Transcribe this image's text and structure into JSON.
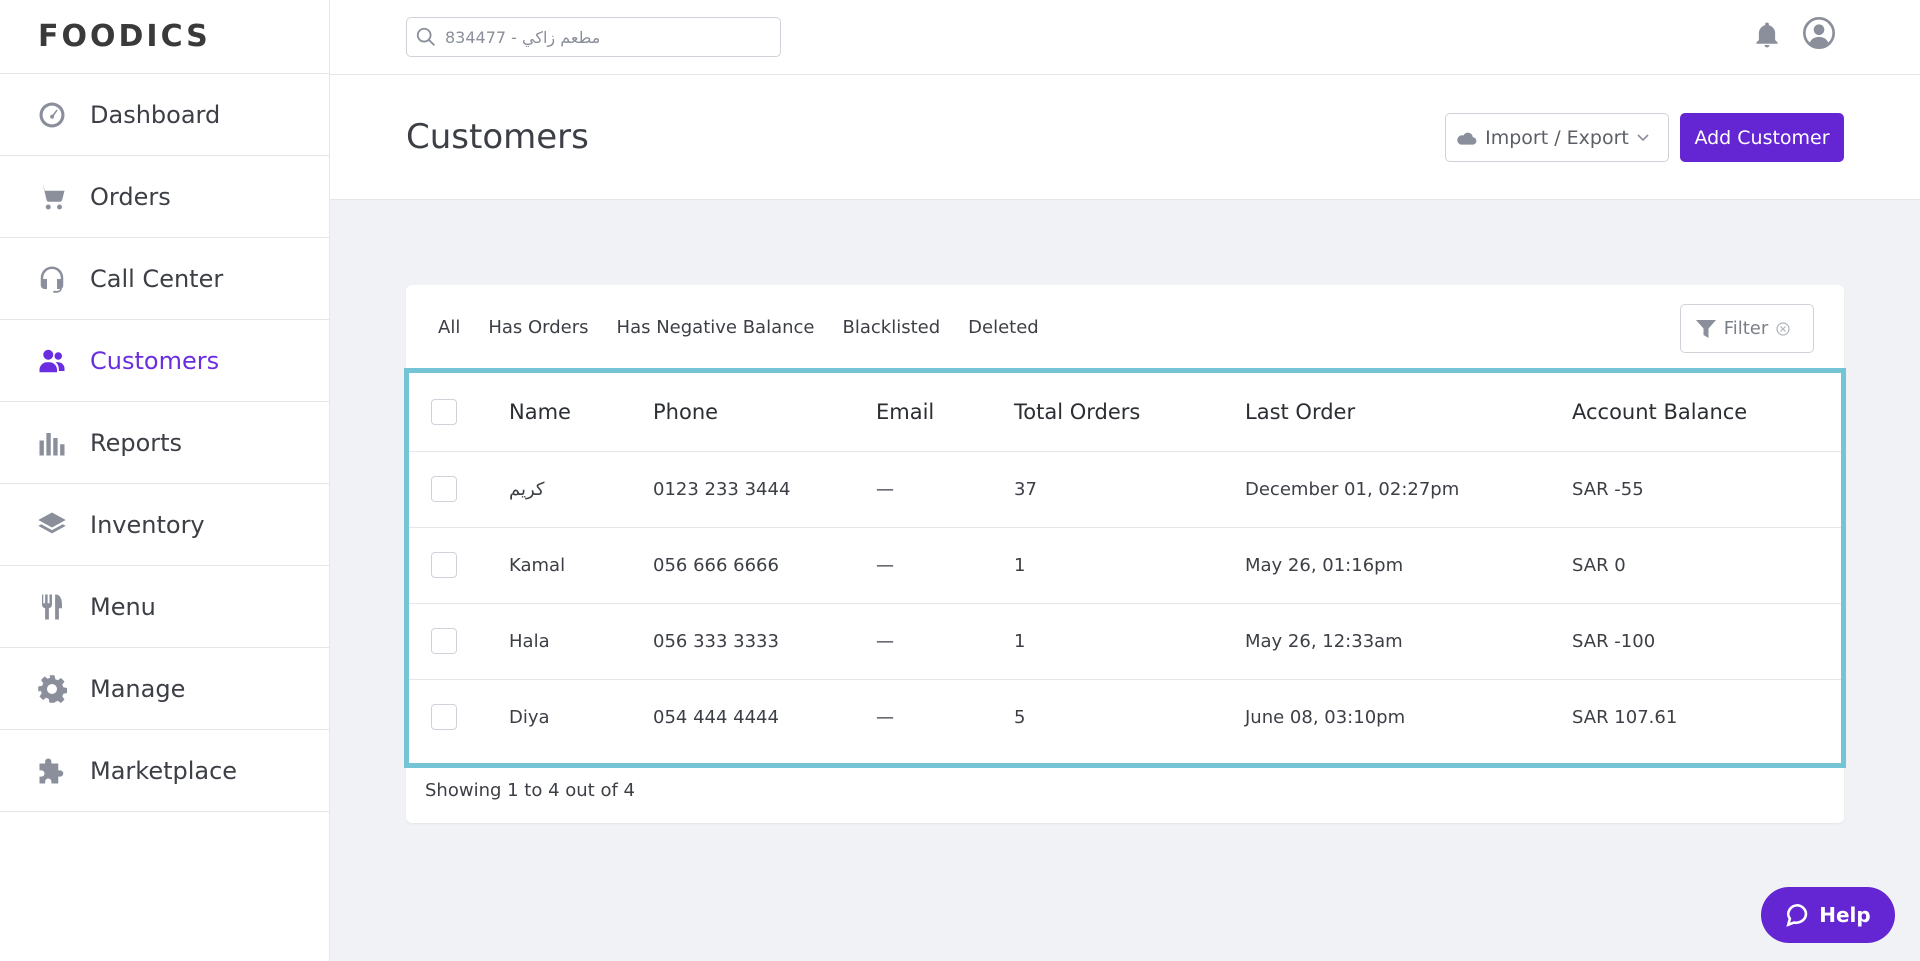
{
  "brand": {
    "logo_text": "FOODICS"
  },
  "sidebar": {
    "items": [
      {
        "label": "Dashboard",
        "icon": "dashboard-icon"
      },
      {
        "label": "Orders",
        "icon": "cart-icon"
      },
      {
        "label": "Call Center",
        "icon": "headset-icon"
      },
      {
        "label": "Customers",
        "icon": "users-icon",
        "active": true
      },
      {
        "label": "Reports",
        "icon": "bar-chart-icon"
      },
      {
        "label": "Inventory",
        "icon": "layers-icon"
      },
      {
        "label": "Menu",
        "icon": "utensils-icon"
      },
      {
        "label": "Manage",
        "icon": "gear-icon"
      },
      {
        "label": "Marketplace",
        "icon": "puzzle-icon"
      }
    ]
  },
  "search": {
    "placeholder": "834477 - مطعم زاكي"
  },
  "header": {
    "title": "Customers",
    "import_export_label": "Import / Export",
    "add_customer_label": "Add Customer"
  },
  "tabs": [
    "All",
    "Has Orders",
    "Has Negative Balance",
    "Blacklisted",
    "Deleted"
  ],
  "filter_label": "Filter",
  "table": {
    "columns": [
      "Name",
      "Phone",
      "Email",
      "Total Orders",
      "Last Order",
      "Account Balance"
    ],
    "rows": [
      {
        "name": "كريم",
        "phone": "0123 233 3444",
        "email": "—",
        "total_orders": "37",
        "last_order": "December 01, 02:27pm",
        "balance": "SAR -55"
      },
      {
        "name": "Kamal",
        "phone": "056 666 6666",
        "email": "—",
        "total_orders": "1",
        "last_order": "May 26, 01:16pm",
        "balance": "SAR 0"
      },
      {
        "name": "Hala",
        "phone": "056 333 3333",
        "email": "—",
        "total_orders": "1",
        "last_order": "May 26, 12:33am",
        "balance": "SAR -100"
      },
      {
        "name": "Diya",
        "phone": "054 444 4444",
        "email": "—",
        "total_orders": "5",
        "last_order": "June 08, 03:10pm",
        "balance": "SAR 107.61"
      }
    ]
  },
  "pagination": {
    "showing_text": "Showing 1 to 4 out of 4"
  },
  "help_label": "Help",
  "colors": {
    "accent": "#6426d3",
    "highlight_border": "#74c4d6"
  }
}
